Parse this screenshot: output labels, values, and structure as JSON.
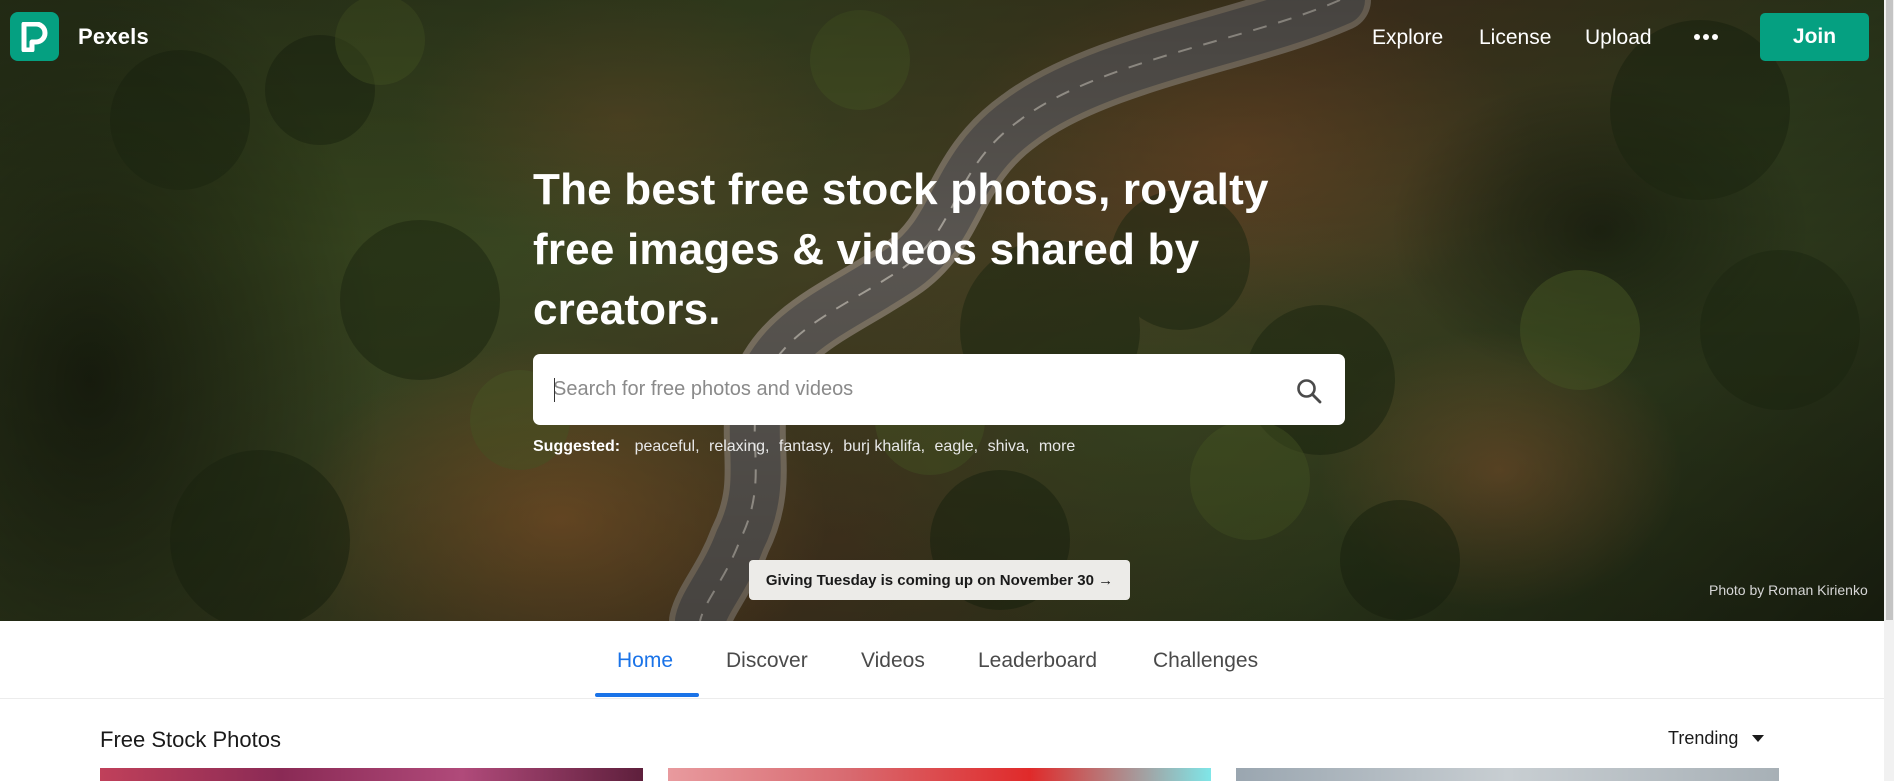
{
  "header": {
    "brand": "Pexels",
    "nav": [
      "Explore",
      "License",
      "Upload"
    ],
    "more_icon": "ellipsis-icon",
    "join_label": "Join"
  },
  "hero": {
    "headline": "The best free stock photos, royalty free images & videos shared by creators.",
    "search_placeholder": "Search for free photos and videos",
    "search_icon": "magnifier-icon",
    "suggested_label": "Suggested:",
    "suggestions": [
      "peaceful",
      "relaxing",
      "fantasy",
      "burj khalifa",
      "eagle",
      "shiva",
      "more"
    ],
    "banner": "Giving Tuesday is coming up on November 30 →",
    "credit": "Photo by Roman Kirienko"
  },
  "tabs": {
    "items": [
      "Home",
      "Discover",
      "Videos",
      "Leaderboard",
      "Challenges"
    ],
    "active": "Home"
  },
  "section": {
    "title": "Free Stock Photos",
    "sort_label": "Trending",
    "sort_icon": "caret-down-icon"
  },
  "colors": {
    "brand": "#05a081",
    "active_tab": "#1a73e8"
  }
}
